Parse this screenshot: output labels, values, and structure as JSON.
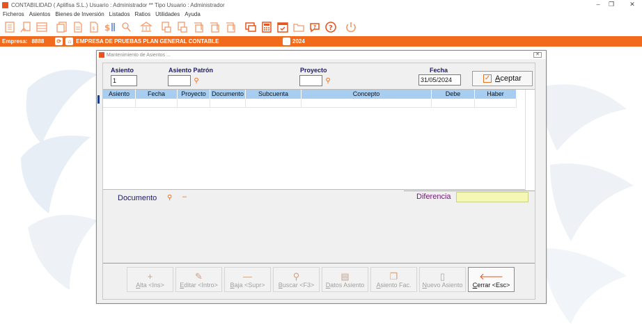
{
  "window": {
    "title": "CONTABILIDAD  ( Aplifisa S.L.)  Usuario : Administrador  ** Tipo Usuario : Administrador",
    "controls": {
      "minimize": "–",
      "restore": "❐",
      "close": "✕"
    }
  },
  "menu": [
    "Ficheros",
    "Asientos",
    "Bienes de Inversión",
    "Listados",
    "Ratios",
    "Utilidades",
    "Ayuda"
  ],
  "toolbar_icons": [
    "ledger-icon",
    "chart-accounts-icon",
    "journal-icon",
    "documents-icon",
    "report-icon",
    "invoice-icon",
    "balance-icon",
    "search-people-icon",
    "bank-icon",
    "print1-icon",
    "print2-icon",
    "print3-icon",
    "print4-icon",
    "print5-icon",
    "remote-icon",
    "calculator-icon",
    "calendar-icon",
    "folder-icon",
    "chat-help-icon",
    "help-icon",
    "power-icon"
  ],
  "company_bar": {
    "label": "Empresa:",
    "number": "8888",
    "name": "EMPRESA DE PRUEBAS PLAN GENERAL CONTABLE",
    "year": "2024",
    "color": "#f26a1b"
  },
  "dialog": {
    "title": "Mantenimiento de Asientos ...",
    "close": "✕",
    "fields": {
      "asiento_label": "Asiento",
      "asiento_value": "1",
      "patron_label": "Asiento Patrón",
      "patron_value": "",
      "proyecto_label": "Proyecto",
      "proyecto_value": "",
      "fecha_label": "Fecha",
      "fecha_value": "31/05/2024"
    },
    "aceptar": {
      "check": "✓",
      "label_first": "A",
      "label_rest": "ceptar"
    },
    "grid": {
      "columns": [
        "Asiento",
        "Fecha",
        "Proyecto",
        "Documento",
        "Subcuenta",
        "Concepto",
        "Debe",
        "Haber"
      ]
    },
    "documento_label": "Documento",
    "diferencia_label": "Diferencia",
    "diferencia_value": "",
    "buttons": [
      {
        "icon": "+",
        "first": "A",
        "rest": "lta <Ins>",
        "active": false
      },
      {
        "icon": "✎",
        "first": "E",
        "rest": "ditar <Intro>",
        "active": false
      },
      {
        "icon": "—",
        "first": "B",
        "rest": "aja <Supr>",
        "active": false
      },
      {
        "icon": "⚲",
        "first": "B",
        "rest": "uscar <F3>",
        "active": false
      },
      {
        "icon": "▤",
        "first": "D",
        "rest": "atos Asiento",
        "active": false
      },
      {
        "icon": "❐",
        "first": "A",
        "rest": "siento Fac.",
        "active": false
      },
      {
        "icon": "▯",
        "first": "N",
        "rest": "uevo Asiento",
        "active": false
      },
      {
        "icon": "🡐",
        "first": "C",
        "rest": "errar <Esc>",
        "active": true
      }
    ]
  }
}
